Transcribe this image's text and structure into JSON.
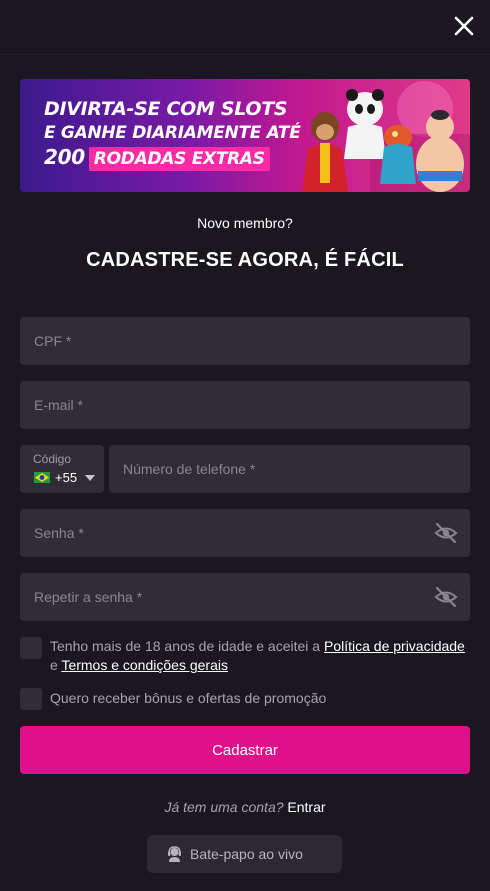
{
  "header": {
    "close_icon": "close-icon"
  },
  "banner": {
    "line1": "DIVIRTA-SE COM SLOTS",
    "line2": "E GANHE DIARIAMENTE ATÉ",
    "line3_number": "200",
    "line3_tag": "RODADAS EXTRAS"
  },
  "intro": {
    "subtitle": "Novo membro?",
    "title": "CADASTRE-SE AGORA, É FÁCIL"
  },
  "form": {
    "cpf": {
      "placeholder": "CPF *",
      "value": ""
    },
    "email": {
      "placeholder": "E-mail *",
      "value": ""
    },
    "phone_code": {
      "label": "Código",
      "value": "+55",
      "flag_icon": "brazil-flag-icon"
    },
    "phone": {
      "placeholder": "Número de telefone *",
      "value": ""
    },
    "password": {
      "placeholder": "Senha *",
      "value": "",
      "toggle_icon": "eye-slash-icon"
    },
    "password_repeat": {
      "placeholder": "Repetir a senha *",
      "value": "",
      "toggle_icon": "eye-slash-icon"
    },
    "terms": {
      "text_before": "Tenho mais de 18 anos de idade e aceitei a ",
      "privacy_link": "Política de privacidade",
      "text_between": " e ",
      "terms_link": "Termos e condições gerais",
      "checked": false
    },
    "promo": {
      "text": "Quero receber bônus e ofertas de promoção",
      "checked": false
    },
    "submit_label": "Cadastrar"
  },
  "footer": {
    "question": "Já tem uma conta?",
    "login_link": "Entrar",
    "chat_label": "Bate-papo ao vivo",
    "chat_icon": "headset-icon"
  },
  "colors": {
    "background": "#1b1720",
    "field": "#312c38",
    "accent": "#e0108b",
    "muted_text": "#a7a2af"
  }
}
